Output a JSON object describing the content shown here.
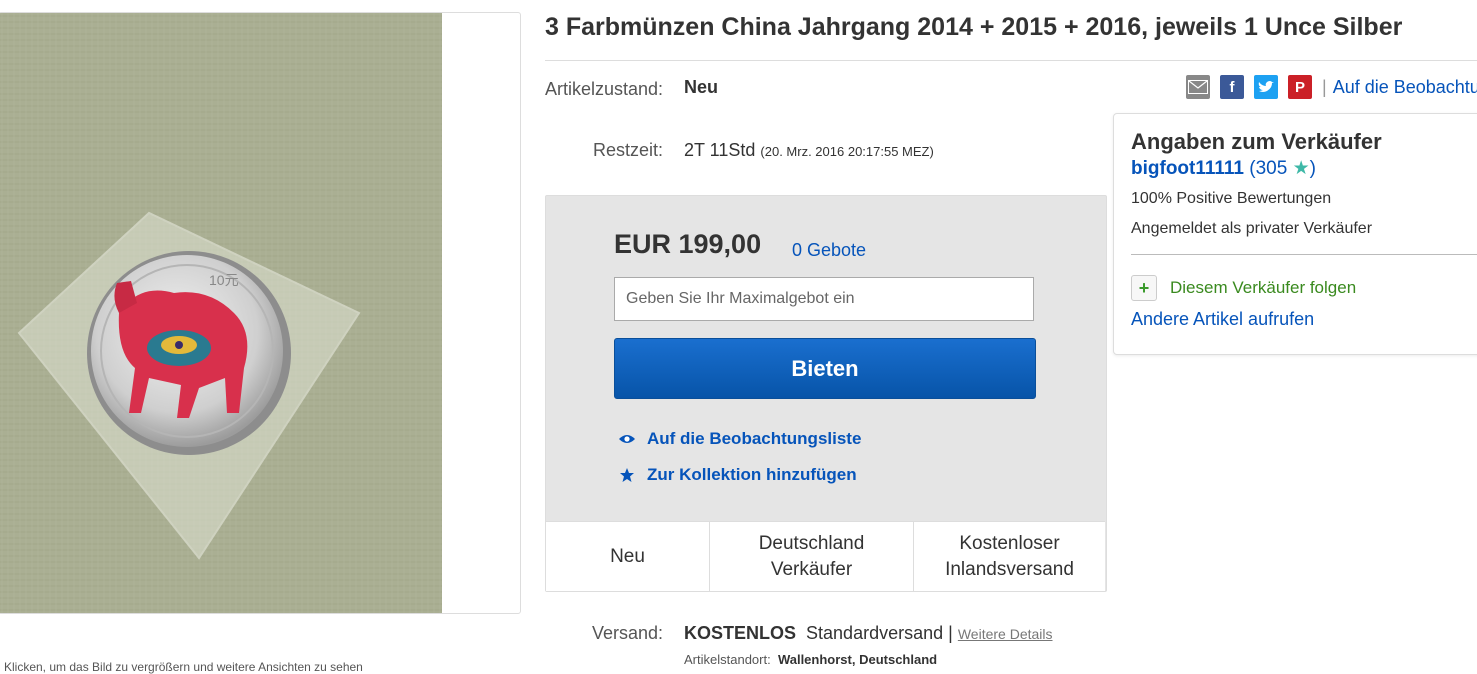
{
  "image": {
    "caption": "Klicken, um das Bild zu vergrößern und weitere Ansichten zu sehen"
  },
  "item": {
    "title": "3 Farbmünzen China Jahrgang 2014 + 2015 + 2016, jeweils 1 Unce Silber",
    "condition_label": "Artikelzustand:",
    "condition_value": "Neu",
    "time_label": "Restzeit:",
    "time_value": "2T 11Std",
    "time_detail": "(20. Mrz. 2016   20:17:55 MEZ)"
  },
  "share": {
    "icons": [
      "email-icon",
      "facebook-icon",
      "twitter-icon",
      "pinterest-icon"
    ],
    "separator": "|",
    "watch_label": "Auf die Beobachtungsliste"
  },
  "bid": {
    "price": "EUR 199,00",
    "bids": "0 Gebote",
    "input_placeholder": "Geben Sie Ihr Maximalgebot ein",
    "button_label": "Bieten",
    "watch_label": "Auf die Beobachtungsliste",
    "collection_label": "Zur Kollektion hinzufügen"
  },
  "highlights": [
    "Neu",
    "Deutschland Verkäufer",
    "Kostenloser Inlandsversand"
  ],
  "shipping": {
    "label": "Versand:",
    "free": "KOSTENLOS",
    "method": "Standardversand",
    "separator": "|",
    "details_link": "Weitere Details",
    "location_label": "Artikelstandort:",
    "location_value": "Wallenhorst, Deutschland"
  },
  "seller": {
    "title": "Angaben zum Verkäufer",
    "name": "bigfoot11111",
    "score_open": "(",
    "score": "305",
    "score_close": ")",
    "feedback": "100% Positive Bewertungen",
    "type": "Angemeldet als privater Verkäufer",
    "follow_label": "Diesem Verkäufer folgen",
    "other_items": "Andere Artikel aufrufen"
  },
  "colors": {
    "link": "#0654ba",
    "button": "#0a5ab8",
    "follow_green": "#3a8a1f",
    "star": "#3eb8a7"
  }
}
